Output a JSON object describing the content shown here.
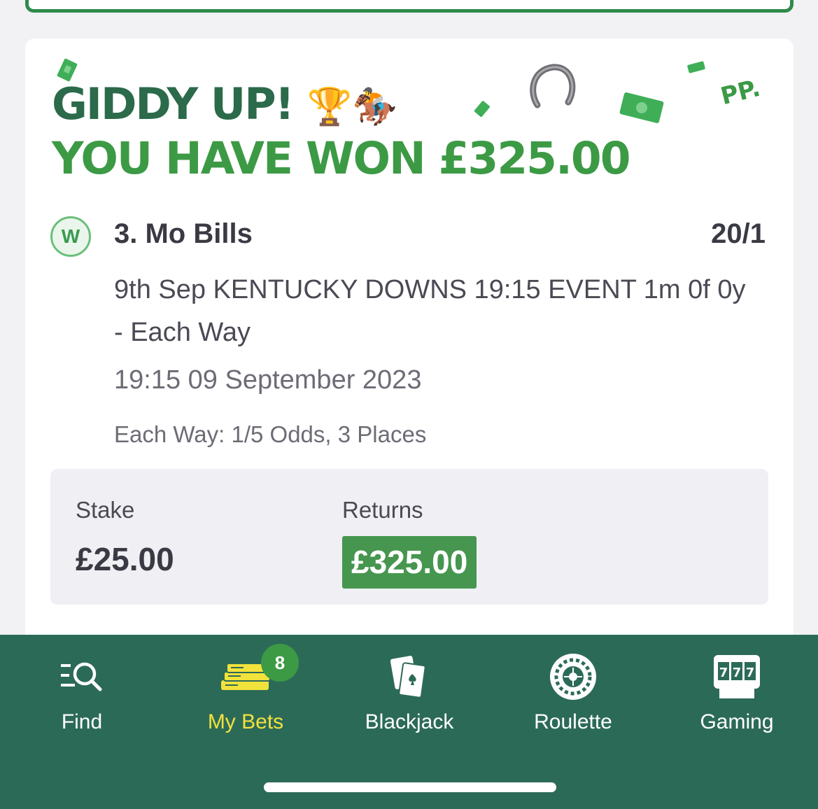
{
  "win_banner": {
    "headline": "GIDDY UP!",
    "headline_emojis": "🏆🏇",
    "won_text": "YOU HAVE WON £325.00",
    "brand_mark": "PP."
  },
  "selection": {
    "result_badge": "W",
    "name": "3. Mo Bills",
    "odds": "20/1",
    "event": "9th Sep KENTUCKY DOWNS 19:15 EVENT 1m 0f 0y - Each Way",
    "time": "19:15 09 September 2023",
    "each_way_terms": "Each Way: 1/5 Odds, 3 Places"
  },
  "stake": {
    "stake_label": "Stake",
    "stake_value": "£25.00",
    "returns_label": "Returns",
    "returns_value": "£325.00"
  },
  "bottom_nav": {
    "items": [
      {
        "label": "Find",
        "icon": "search-list-icon"
      },
      {
        "label": "My Bets",
        "icon": "money-stack-icon",
        "badge": "8",
        "active": true
      },
      {
        "label": "Blackjack",
        "icon": "playing-cards-icon"
      },
      {
        "label": "Roulette",
        "icon": "roulette-wheel-icon"
      },
      {
        "label": "Gaming",
        "icon": "slot-machine-icon"
      }
    ]
  },
  "colors": {
    "nav_background": "#2c6a58",
    "headline_dark_green": "#2b6a4a",
    "headline_green": "#3c9a45",
    "active_nav": "#f2e23c",
    "returns_highlight": "#46964f"
  }
}
